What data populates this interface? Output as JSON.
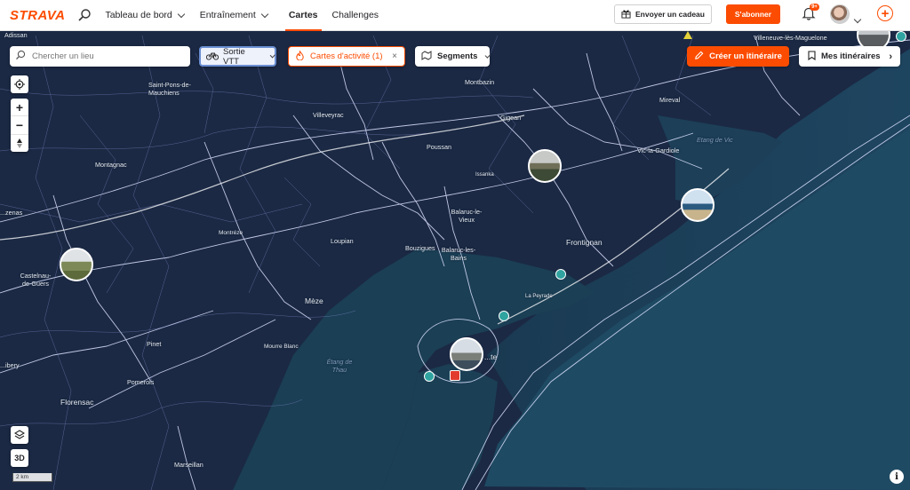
{
  "header": {
    "logo": "STRAVA",
    "nav": [
      {
        "label": "Tableau de bord",
        "dropdown": true
      },
      {
        "label": "Entraînement",
        "dropdown": true
      },
      {
        "label": "Cartes",
        "active": true
      },
      {
        "label": "Challenges"
      }
    ],
    "gift_label": "Envoyer un cadeau",
    "subscribe_label": "S'abonner",
    "notification_count": "9+"
  },
  "map_controls": {
    "search_placeholder": "Chercher un lieu",
    "sport_chip": "Sortie VTT",
    "heatmap_chip": "Cartes d'activité (1)",
    "segments_chip": "Segments",
    "create_route": "Créer un itinéraire",
    "my_routes": "Mes itinéraires",
    "view_3d": "3D",
    "scale": "2 km"
  },
  "places": {
    "villeneuve": "Villeneuve-lès-Maguelone",
    "adissan": "Adissan",
    "saint_pons": "Saint-Pons-de-Mauchiens",
    "montbazin": "Montbazin",
    "villeveyrac": "Villeveyrac",
    "gigean": "Gigean",
    "mireval": "Mireval",
    "cabrieres": "Cabrières",
    "paulhan": "...agnan-l'Ebre",
    "etang_vic": "Etang de Vic",
    "poussan": "Poussan",
    "vic": "Vic-la-Gardiole",
    "montagnac": "Montagnac",
    "issanka": "Issanka",
    "pezenas": "...zenas",
    "balaruc_vieux": "Balaruc-le-Vieux",
    "frontignan": "Frontignan",
    "montreze": "Montréze",
    "loupian": "Loupian",
    "bouzigues": "Bouzigues",
    "balaruc_bains": "Balaruc-les-Bains",
    "castelnau": "Castelnau-de-Guers",
    "la_peyrade": "La Peyrade",
    "meze": "Mèze",
    "pinet": "Pinet",
    "mourre": "Mourre Blanc",
    "etang_thau": "Étang de Thau",
    "sete": "...te",
    "pomerols": "Pomerols",
    "florensac": "Florensac",
    "bessan": "...ibery",
    "marseillan": "Marseillan"
  },
  "colors": {
    "brand": "#fc4c02",
    "map_land": "#1b2944",
    "map_water": "#1b3f55",
    "heat_lines": "#d7dcff"
  }
}
